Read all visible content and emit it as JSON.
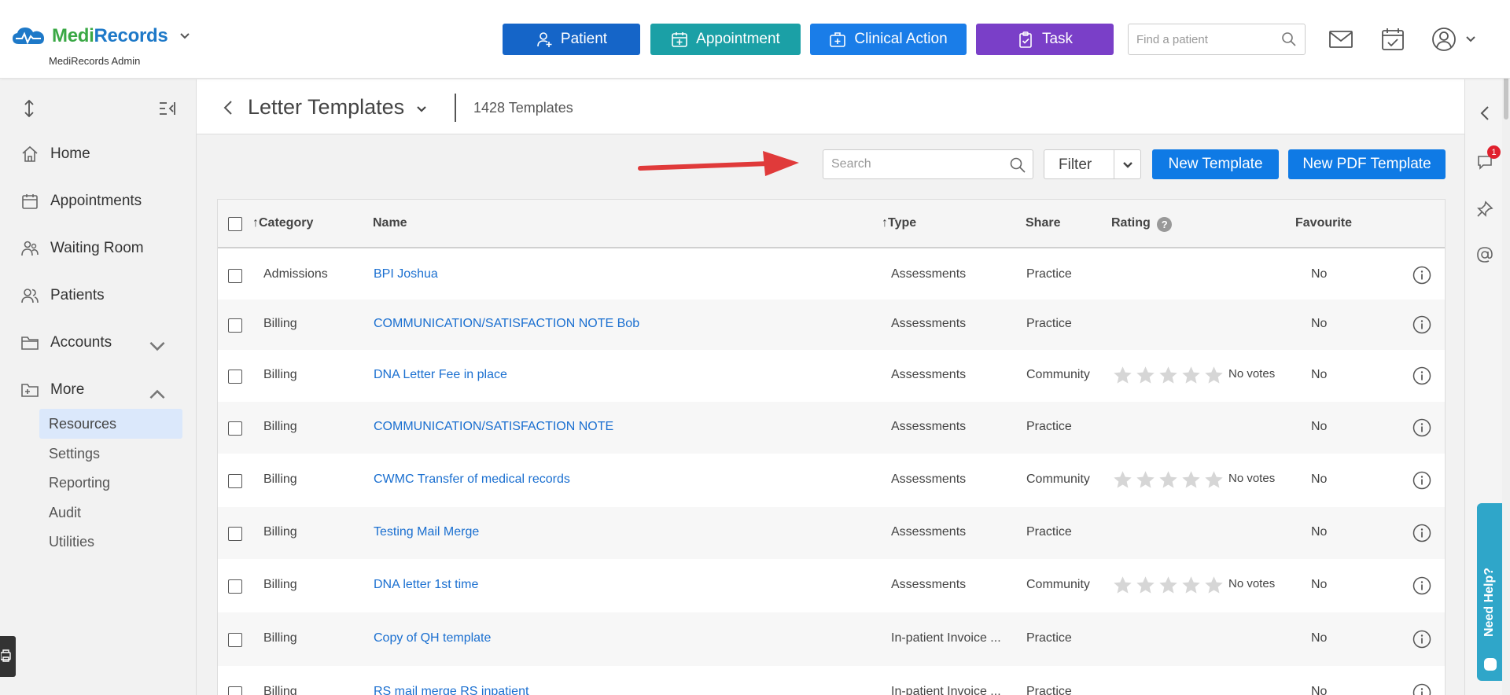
{
  "app": {
    "logo_text_1": "Medi",
    "logo_text_2": "Records",
    "account_name": "MediRecords Admin"
  },
  "topbar": {
    "patient_label": "Patient",
    "appointment_label": "Appointment",
    "clinical_action_label": "Clinical Action",
    "task_label": "Task",
    "find_patient_placeholder": "Find a patient"
  },
  "sidebar": {
    "home": "Home",
    "appointments": "Appointments",
    "waiting_room": "Waiting Room",
    "patients": "Patients",
    "accounts": "Accounts",
    "more": "More",
    "sub_items": [
      "Resources",
      "Settings",
      "Reporting",
      "Audit",
      "Utilities"
    ]
  },
  "header": {
    "title": "Letter Templates",
    "count": "1428 Templates"
  },
  "toolbar": {
    "search_placeholder": "Search",
    "filter_label": "Filter",
    "new_template_label": "New Template",
    "new_pdf_template_label": "New PDF Template"
  },
  "table": {
    "columns": {
      "category": "Category",
      "name": "Name",
      "type": "Type",
      "share": "Share",
      "rating": "Rating",
      "favourite": "Favourite"
    },
    "rows": [
      {
        "category": "Admissions",
        "name": "BPI Joshua",
        "type": "Assessments",
        "share": "Practice",
        "rating": "",
        "favourite": "No"
      },
      {
        "category": "Billing",
        "name": "COMMUNICATION/SATISFACTION NOTE Bob",
        "type": "Assessments",
        "share": "Practice",
        "rating": "",
        "favourite": "No"
      },
      {
        "category": "Billing",
        "name": "DNA Letter Fee in place",
        "type": "Assessments",
        "share": "Community",
        "rating": "No votes",
        "favourite": "No"
      },
      {
        "category": "Billing",
        "name": "COMMUNICATION/SATISFACTION NOTE",
        "type": "Assessments",
        "share": "Practice",
        "rating": "",
        "favourite": "No"
      },
      {
        "category": "Billing",
        "name": "CWMC Transfer of medical records",
        "type": "Assessments",
        "share": "Community",
        "rating": "No votes",
        "favourite": "No"
      },
      {
        "category": "Billing",
        "name": "Testing Mail Merge",
        "type": "Assessments",
        "share": "Practice",
        "rating": "",
        "favourite": "No"
      },
      {
        "category": "Billing",
        "name": "DNA letter 1st time",
        "type": "Assessments",
        "share": "Community",
        "rating": "No votes",
        "favourite": "No"
      },
      {
        "category": "Billing",
        "name": "Copy of QH template",
        "type": "In-patient Invoice ...",
        "share": "Practice",
        "rating": "",
        "favourite": "No"
      },
      {
        "category": "Billing",
        "name": "RS mail merge RS inpatient",
        "type": "In-patient Invoice ...",
        "share": "Practice",
        "rating": "",
        "favourite": "No"
      }
    ]
  },
  "right_bar": {
    "notification_count": "1",
    "need_help_label": "Need Help?"
  },
  "colors": {
    "patient_btn": "#1565c8",
    "appointment_btn": "#1ba0a6",
    "clinical_btn": "#1a7de8",
    "task_btn": "#7a3fc8",
    "primary_btn": "#0f7ae5",
    "link": "#1a6fd0",
    "arrow": "#e03a3a"
  }
}
